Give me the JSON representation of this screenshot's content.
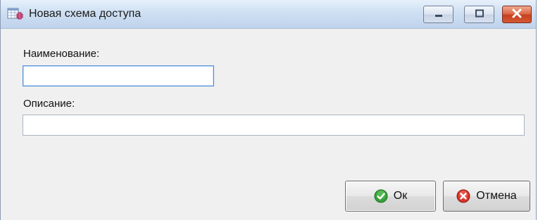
{
  "window": {
    "title": "Новая схема доступа",
    "controls": {
      "minimize_icon": "minimize-icon",
      "maximize_icon": "maximize-icon",
      "close_icon": "close-icon"
    }
  },
  "form": {
    "name_label": "Наименование:",
    "name_value": "",
    "description_label": "Описание:",
    "description_value": ""
  },
  "buttons": {
    "ok_label": "Ок",
    "ok_icon": "green-check-icon",
    "cancel_label": "Отмена",
    "cancel_icon": "red-x-icon"
  },
  "colors": {
    "ok_icon": "#3aa13a",
    "cancel_icon": "#d8342c",
    "focus_border": "#4f90d9"
  }
}
